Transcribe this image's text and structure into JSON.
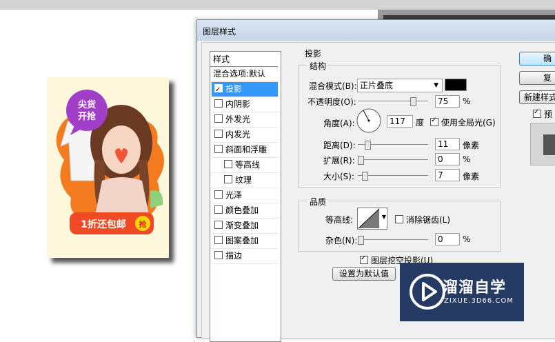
{
  "dialog": {
    "title": "图层样式",
    "style_list": {
      "header": "样式",
      "items": [
        {
          "label": "混合选项:默认",
          "checkbox": false,
          "checked": false,
          "indent": 0,
          "selected": false
        },
        {
          "label": "投影",
          "checkbox": true,
          "checked": true,
          "indent": 0,
          "selected": true
        },
        {
          "label": "内阴影",
          "checkbox": true,
          "checked": false,
          "indent": 0,
          "selected": false
        },
        {
          "label": "外发光",
          "checkbox": true,
          "checked": false,
          "indent": 0,
          "selected": false
        },
        {
          "label": "内发光",
          "checkbox": true,
          "checked": false,
          "indent": 0,
          "selected": false
        },
        {
          "label": "斜面和浮雕",
          "checkbox": true,
          "checked": false,
          "indent": 0,
          "selected": false
        },
        {
          "label": "等高线",
          "checkbox": true,
          "checked": false,
          "indent": 1,
          "selected": false
        },
        {
          "label": "纹理",
          "checkbox": true,
          "checked": false,
          "indent": 1,
          "selected": false
        },
        {
          "label": "光泽",
          "checkbox": true,
          "checked": false,
          "indent": 0,
          "selected": false
        },
        {
          "label": "颜色叠加",
          "checkbox": true,
          "checked": false,
          "indent": 0,
          "selected": false
        },
        {
          "label": "渐变叠加",
          "checkbox": true,
          "checked": false,
          "indent": 0,
          "selected": false
        },
        {
          "label": "图案叠加",
          "checkbox": true,
          "checked": false,
          "indent": 0,
          "selected": false
        },
        {
          "label": "描边",
          "checkbox": true,
          "checked": false,
          "indent": 0,
          "selected": false
        }
      ]
    },
    "drop_shadow": {
      "title": "投影",
      "structure": {
        "title": "结构",
        "blend_mode_label": "混合模式(B):",
        "blend_mode_value": "正片叠底",
        "shadow_color": "#000000",
        "opacity_label": "不透明度(O):",
        "opacity_value": "75",
        "opacity_unit": "%",
        "angle_label": "角度(A):",
        "angle_value": "117",
        "angle_unit": "度",
        "global_light_label": "使用全局光(G)",
        "global_light_checked": true,
        "distance_label": "距离(D):",
        "distance_value": "11",
        "distance_unit": "像素",
        "spread_label": "扩展(R):",
        "spread_value": "0",
        "spread_unit": "%",
        "size_label": "大小(S):",
        "size_value": "7",
        "size_unit": "像素"
      },
      "quality": {
        "title": "品质",
        "contour_label": "等高线:",
        "anti_alias_label": "消除锯齿(L)",
        "noise_label": "杂色(N):",
        "noise_value": "0",
        "noise_unit": "%"
      },
      "knockout_label": "图层挖空投影(U)",
      "knockout_checked": true,
      "default_button": "设置为默认值"
    },
    "right_buttons": {
      "ok": "确",
      "reset": "复",
      "new_style": "新建样式",
      "preview": "预"
    }
  },
  "poster": {
    "tag_line1": "尖货",
    "tag_line2": "开抢",
    "banner": "1折还包邮",
    "grab": "抢"
  },
  "watermark": {
    "name": "溜溜自学",
    "url": "ZIXUE.3D66.COM"
  }
}
